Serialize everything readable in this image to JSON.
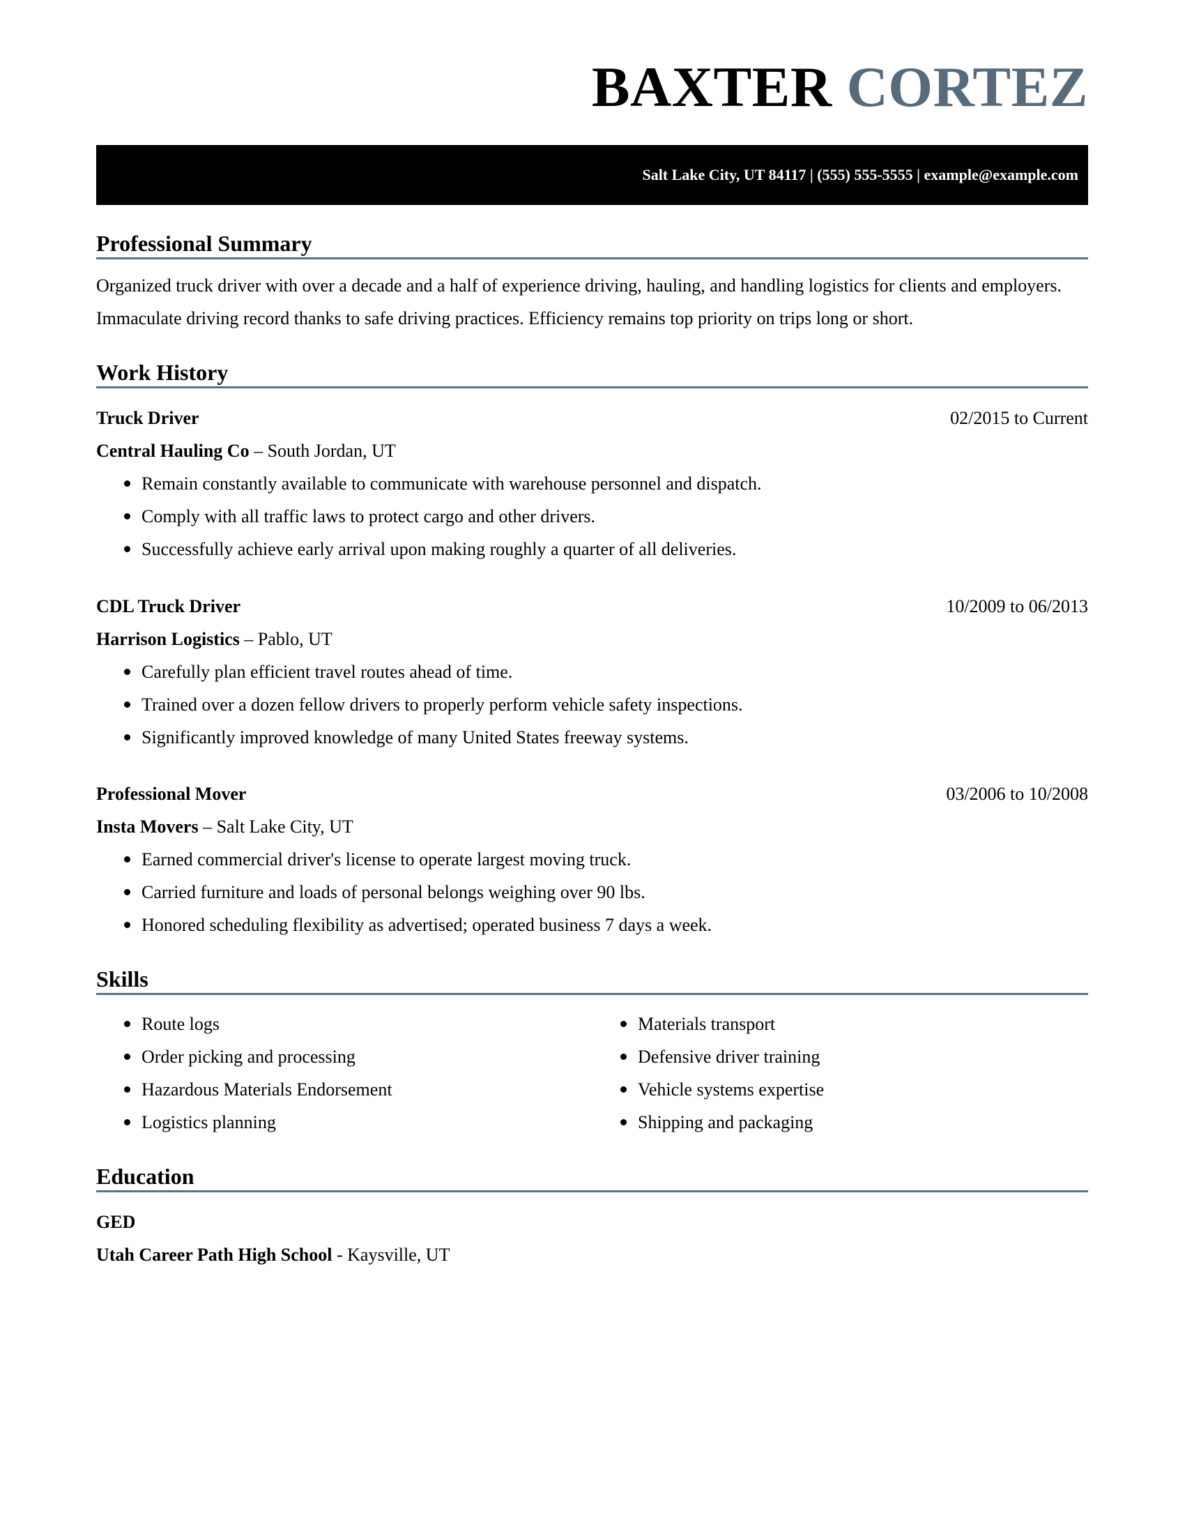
{
  "header": {
    "first_name": "BAXTER",
    "last_name": "CORTEZ",
    "contact": "Salt Lake City, UT 84117 | (555) 555-5555 | example@example.com",
    "accent_color": "#576b7a"
  },
  "summary": {
    "heading": "Professional Summary",
    "text": "Organized truck driver with over a decade and a half of experience driving, hauling, and handling logistics for clients and employers. Immaculate driving record thanks to safe driving practices. Efficiency remains top priority on trips long or short."
  },
  "work": {
    "heading": "Work History",
    "jobs": [
      {
        "title": "Truck Driver",
        "dates": "02/2015 to Current",
        "company": "Central Hauling Co",
        "location": " – South Jordan, UT",
        "bullets": [
          "Remain constantly available to communicate with warehouse personnel and dispatch.",
          "Comply with all traffic laws to protect cargo and other drivers.",
          "Successfully achieve early arrival upon making roughly a quarter of all deliveries."
        ]
      },
      {
        "title": "CDL Truck Driver",
        "dates": "10/2009 to 06/2013",
        "company": "Harrison Logistics",
        "location": " – Pablo, UT",
        "bullets": [
          "Carefully plan efficient travel routes ahead of time.",
          "Trained over a dozen fellow drivers to properly perform vehicle safety inspections.",
          "Significantly improved knowledge of many United States freeway systems."
        ]
      },
      {
        "title": "Professional Mover",
        "dates": "03/2006 to 10/2008",
        "company": "Insta Movers",
        "location": " – Salt Lake City, UT",
        "bullets": [
          "Earned commercial driver's license to operate largest moving truck.",
          "Carried furniture and loads of personal belongs weighing over 90 lbs.",
          "Honored scheduling flexibility as advertised; operated business 7 days a week."
        ]
      }
    ]
  },
  "skills": {
    "heading": "Skills",
    "left": [
      "Route logs",
      "Order picking and processing",
      "Hazardous Materials Endorsement",
      "Logistics planning"
    ],
    "right": [
      "Materials transport",
      "Defensive driver training",
      "Vehicle systems expertise",
      "Shipping and packaging"
    ]
  },
  "education": {
    "heading": "Education",
    "degree": "GED",
    "school": "Utah Career Path High School",
    "location": " - Kaysville, UT"
  }
}
